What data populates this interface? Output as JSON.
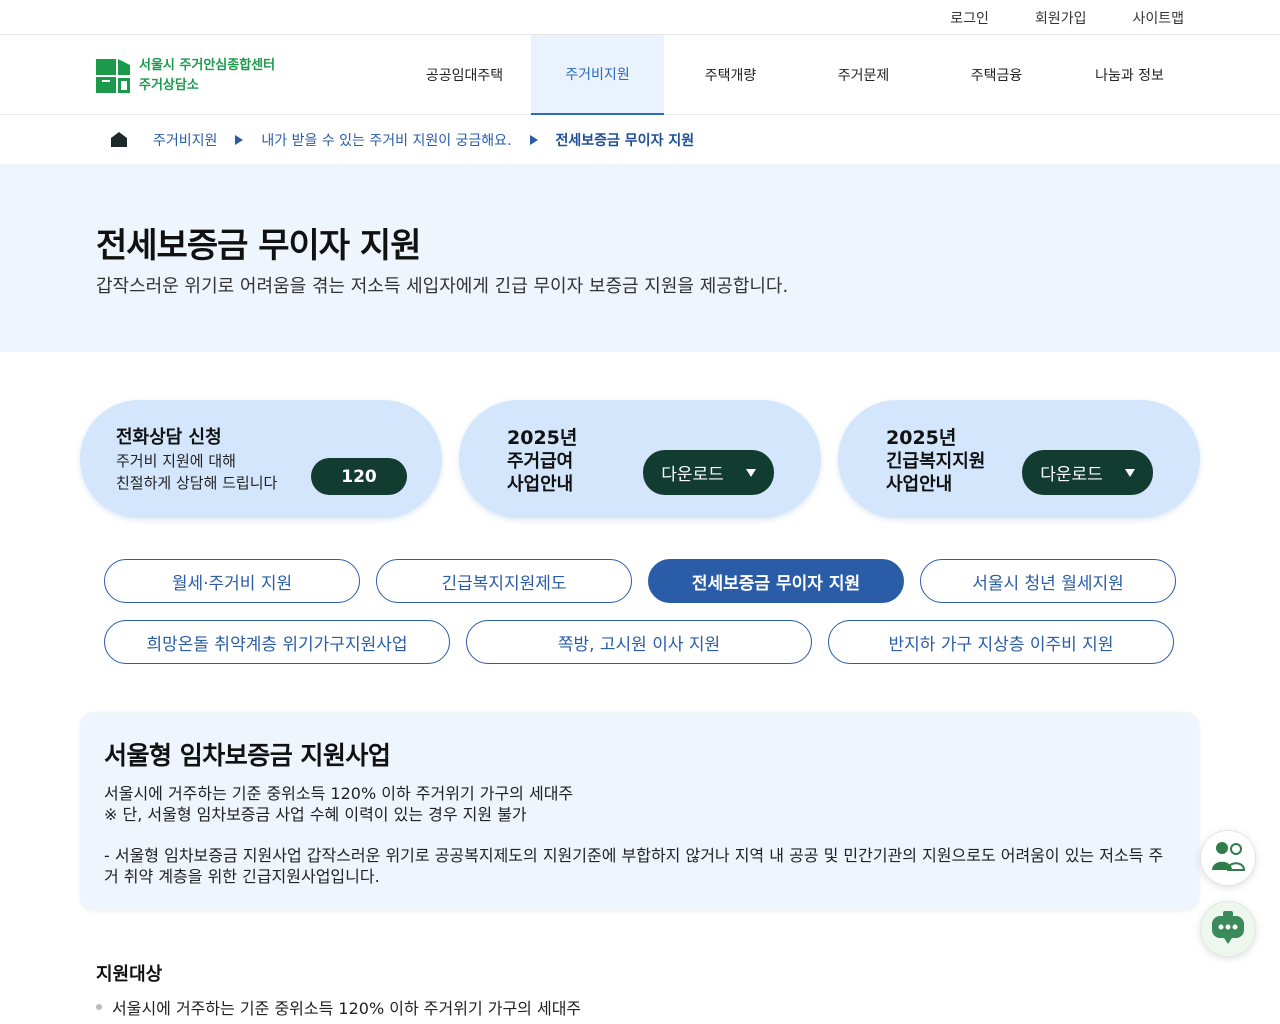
{
  "util": {
    "login": "로그인",
    "signup": "회원가입",
    "sitemap": "사이트맵"
  },
  "logo": {
    "line1": "서울시 주거안심종합센터",
    "line2": "주거상담소"
  },
  "gnb": [
    {
      "label": "공공임대주택"
    },
    {
      "label": "주거비지원"
    },
    {
      "label": "주택개량"
    },
    {
      "label": "주거문제"
    },
    {
      "label": "주택금융"
    },
    {
      "label": "나눔과 정보"
    }
  ],
  "breadcrumb": {
    "level1": "주거비지원",
    "level2": "내가 받을 수 있는 주거비 지원이 궁금해요.",
    "current": "전세보증금 무이자 지원"
  },
  "hero": {
    "title": "전세보증금 무이자 지원",
    "desc": "갑작스러운 위기로 어려움을 겪는 저소득 세입자에게 긴급 무이자 보증금 지원을 제공합니다."
  },
  "cards": {
    "phone": {
      "title": "전화상담 신청",
      "sub1": "주거비 지원에 대해",
      "sub2": "친절하게 상담해 드립니다",
      "button": "120"
    },
    "housing": {
      "year": "2025년",
      "line1": "주거급여",
      "line2": "사업안내",
      "button": "다운로드"
    },
    "welfare": {
      "year": "2025년",
      "line1": "긴급복지지원",
      "line2": "사업안내",
      "button": "다운로드"
    }
  },
  "tabs_row1": [
    "월세·주거비 지원",
    "긴급복지지원제도",
    "전세보증금 무이자 지원",
    "서울시 청년 월세지원"
  ],
  "tabs_row2": [
    "희망온돌 취약계층 위기가구지원사업",
    "쪽방, 고시원 이사 지원",
    "반지하 가구 지상층 이주비 지원"
  ],
  "info": {
    "title": "서울형 임차보증금 지원사업",
    "line1": "서울시에 거주하는 기준 중위소득 120% 이하 주거위기 가구의 세대주",
    "line2": "※ 단, 서울형 임차보증금 사업 수혜 이력이 있는 경우 지원 불가",
    "line3": "- 서울형 임차보증금 지원사업 갑작스러운 위기로 공공복지제도의 지원기준에 부합하지 않거나 지역 내 공공 및 민간기관의 지원으로도 어려움이 있는 저소득 주거 취약 계층을 위한 긴급지원사업입니다."
  },
  "section": {
    "title": "지원대상",
    "item1": "서울시에 거주하는 기준 중위소득 120% 이하 주거위기 가구의 세대주"
  },
  "colors": {
    "brand_green": "#1a9a4a",
    "primary_blue": "#2a5ca8",
    "dark_button": "#123c30",
    "hero_bg": "#eef5fd"
  },
  "icons": {
    "home": "home-icon",
    "counsel": "counselor-icon",
    "chat": "chatbot-icon"
  }
}
